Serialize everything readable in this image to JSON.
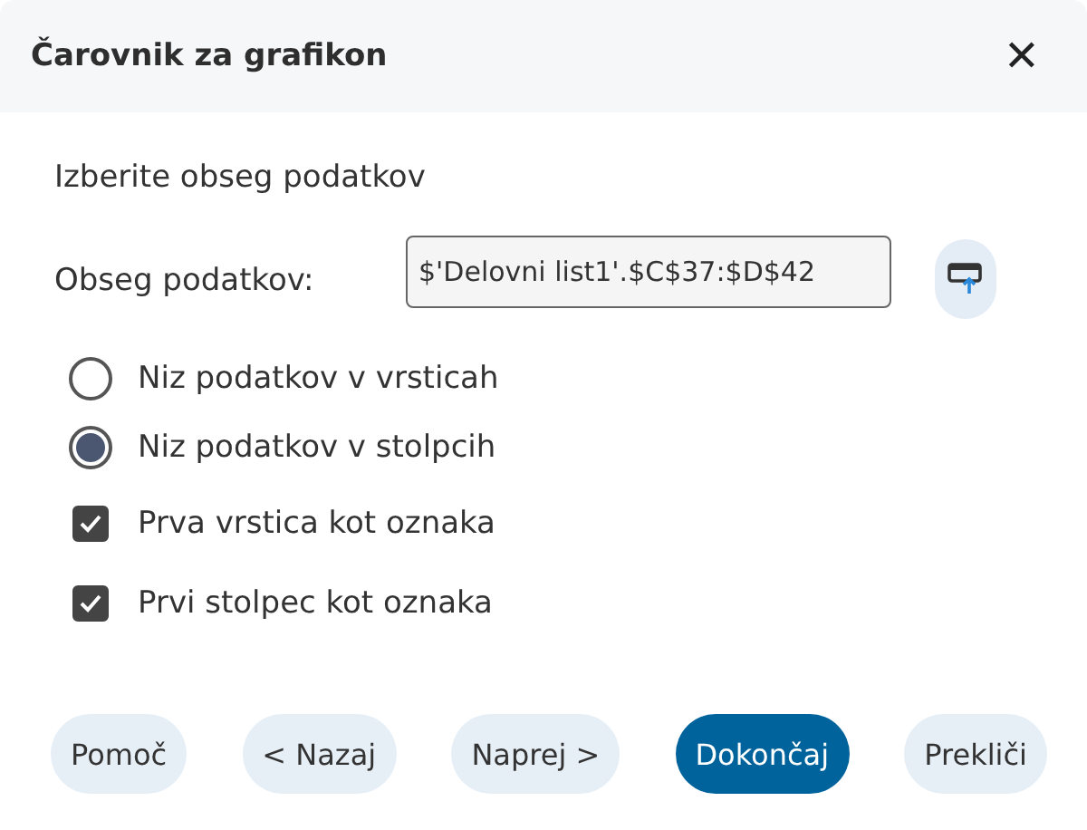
{
  "window": {
    "title": "Čarovnik za grafikon",
    "close": "✕"
  },
  "section_title": "Izberite obseg podatkov",
  "range": {
    "label": "Obseg podatkov:",
    "value": "$'Delovni list1'.$C$37:$D$42"
  },
  "series_options": [
    {
      "label": "Niz podatkov v vrsticah",
      "selected": false
    },
    {
      "label": "Niz podatkov v stolpcih",
      "selected": true
    }
  ],
  "label_options": [
    {
      "label": "Prva vrstica kot oznaka",
      "checked": true
    },
    {
      "label": "Prvi stolpec kot oznaka",
      "checked": true
    }
  ],
  "buttons": [
    {
      "label": "Pomoč",
      "kind": "default"
    },
    {
      "label": "< Nazaj",
      "kind": "default"
    },
    {
      "label": "Naprej >",
      "kind": "default"
    },
    {
      "label": "Dokončaj",
      "kind": "primary"
    },
    {
      "label": "Prekliči",
      "kind": "default"
    }
  ]
}
